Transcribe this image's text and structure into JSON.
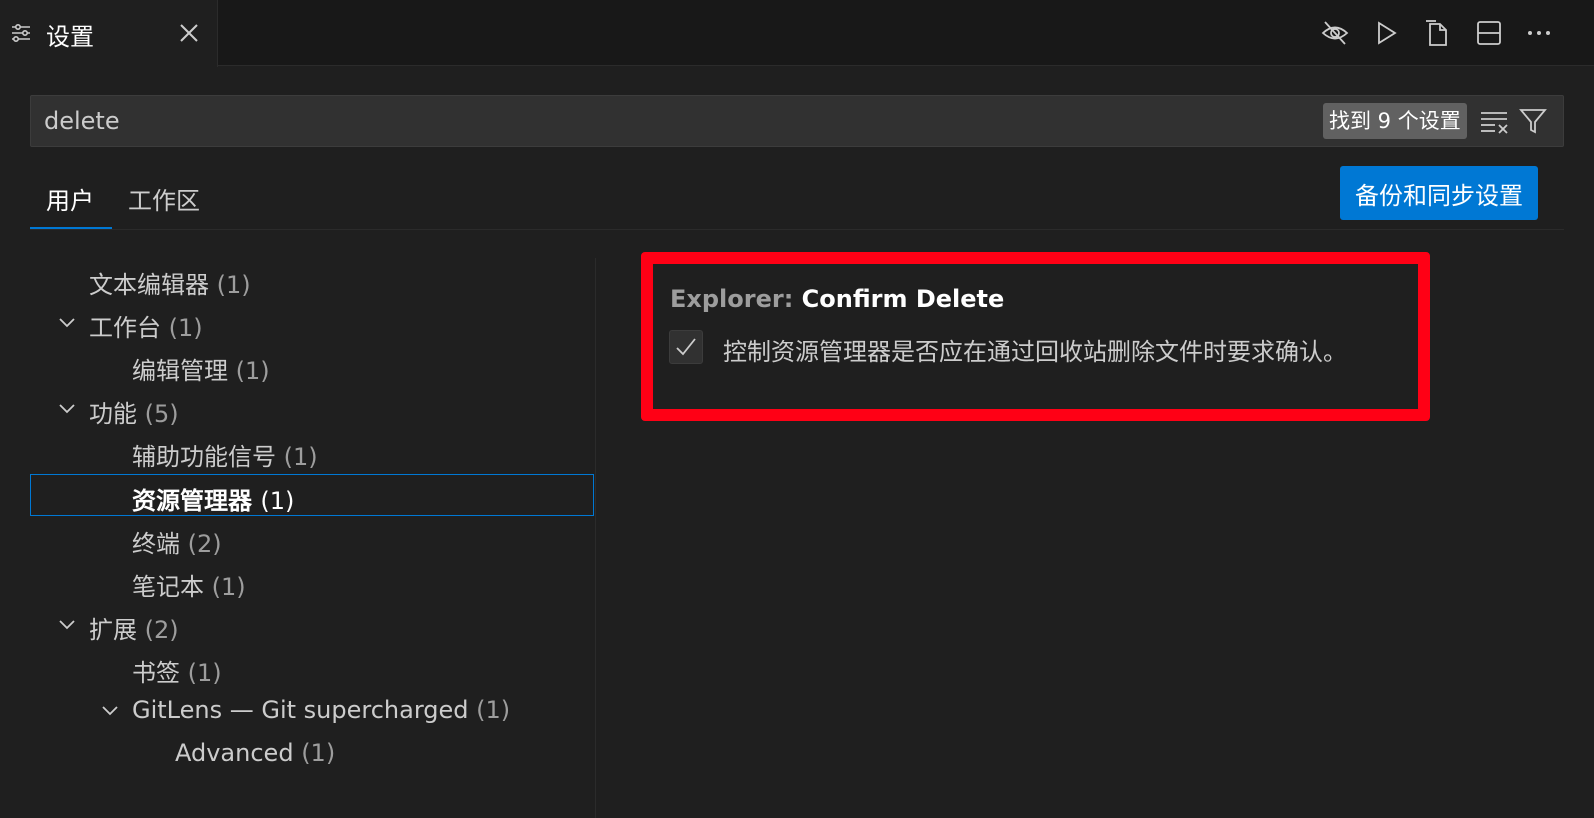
{
  "editor_tab": {
    "title": "设置"
  },
  "search": {
    "value": "delete",
    "result_badge": "找到 9 个设置"
  },
  "scopes": {
    "user": "用户",
    "workspace": "工作区"
  },
  "backup_button": "备份和同步设置",
  "toc": [
    {
      "label": "文本编辑器",
      "count": "(1)",
      "expanded": false
    },
    {
      "label": "工作台",
      "count": "(1)",
      "expanded": true
    },
    {
      "label": "编辑管理",
      "count": "(1)"
    },
    {
      "label": "功能",
      "count": "(5)",
      "expanded": true
    },
    {
      "label": "辅助功能信号",
      "count": "(1)"
    },
    {
      "label": "资源管理器",
      "count": "(1)",
      "selected": true
    },
    {
      "label": "终端",
      "count": "(2)"
    },
    {
      "label": "笔记本",
      "count": "(1)"
    },
    {
      "label": "扩展",
      "count": "(2)",
      "expanded": true
    },
    {
      "label": "书签",
      "count": "(1)"
    },
    {
      "label": "GitLens — Git supercharged",
      "count": "(1)",
      "expanded": true
    },
    {
      "label": "Advanced",
      "count": "(1)"
    }
  ],
  "setting": {
    "category": "Explorer: ",
    "name": "Confirm Delete",
    "checked": true,
    "description": "控制资源管理器是否应在通过回收站删除文件时要求确认。"
  },
  "colors": {
    "accent": "#0078d4",
    "highlight": "#ff0015",
    "background": "#1f1f1f"
  }
}
